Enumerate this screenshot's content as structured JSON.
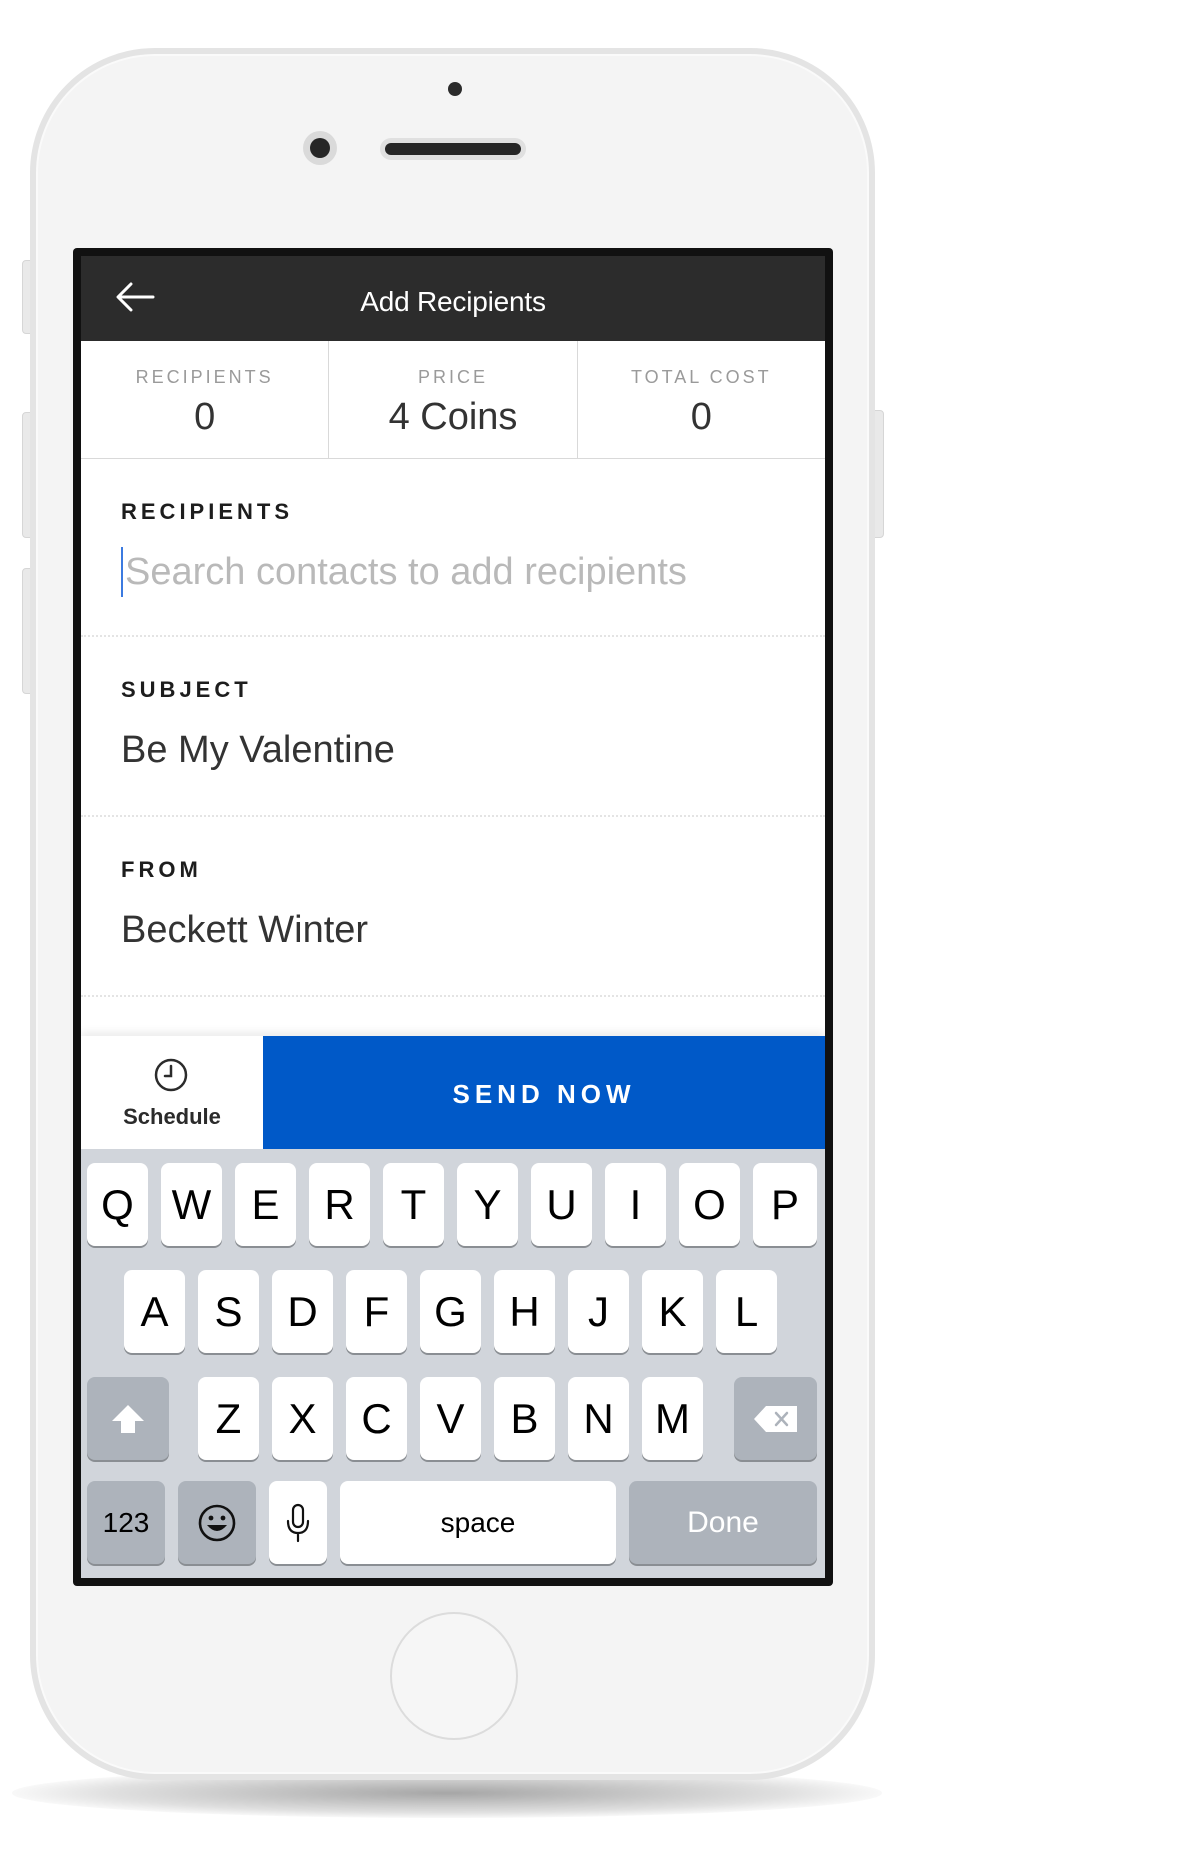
{
  "appbar": {
    "title": "Add Recipients"
  },
  "stats": [
    {
      "label": "RECIPIENTS",
      "value": "0"
    },
    {
      "label": "PRICE",
      "value": "4 Coins"
    },
    {
      "label": "TOTAL COST",
      "value": "0"
    }
  ],
  "recipients": {
    "label": "RECIPIENTS",
    "value": "",
    "placeholder": "Search contacts to add recipients"
  },
  "subject": {
    "label": "SUBJECT",
    "value": "Be My Valentine"
  },
  "from": {
    "label": "FROM",
    "value": "Beckett Winter"
  },
  "actions": {
    "schedule_label": "Schedule",
    "send_label": "SEND NOW"
  },
  "keyboard": {
    "row1": [
      "Q",
      "W",
      "E",
      "R",
      "T",
      "Y",
      "U",
      "I",
      "O",
      "P"
    ],
    "row2": [
      "A",
      "S",
      "D",
      "F",
      "G",
      "H",
      "J",
      "K",
      "L"
    ],
    "row3": [
      "Z",
      "X",
      "C",
      "V",
      "B",
      "N",
      "M"
    ],
    "numbers_label": "123",
    "space_label": "space",
    "done_label": "Done"
  },
  "colors": {
    "appbar": "#2c2c2c",
    "send_button": "#0059c8",
    "keyboard_bg": "#d1d5db",
    "key_dark": "#adb3bb"
  },
  "icons": {
    "back": "arrow-left-icon",
    "schedule": "clock-icon",
    "shift": "shift-icon",
    "delete": "backspace-icon",
    "emoji": "emoji-icon",
    "mic": "microphone-icon"
  }
}
